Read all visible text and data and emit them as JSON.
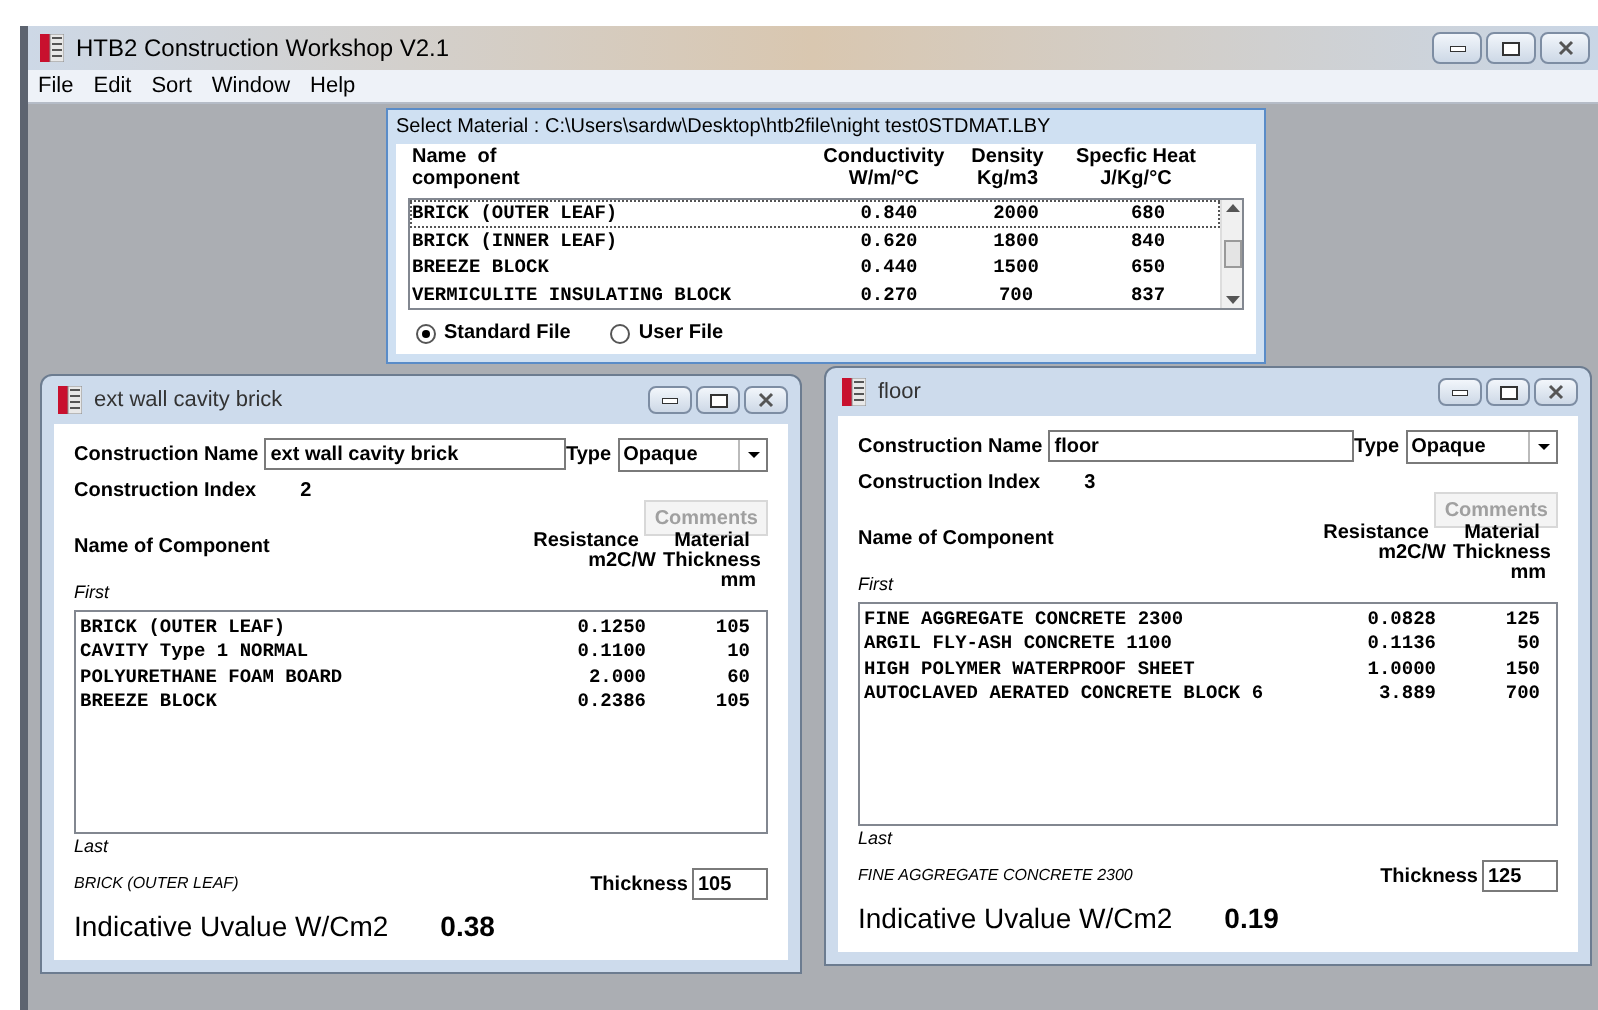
{
  "app": {
    "title": "HTB2 Construction Workshop V2.1",
    "menu": [
      "File",
      "Edit",
      "Sort",
      "Window",
      "Help"
    ]
  },
  "material_dialog": {
    "title": "Select Material : C:\\Users\\sardw\\Desktop\\htb2file\\night test0STDMAT.LBY",
    "columns": [
      {
        "lines": [
          "Name  of",
          "component"
        ]
      },
      {
        "lines": [
          "Conductivity",
          "W/m/°C"
        ]
      },
      {
        "lines": [
          "Density",
          "Kg/m3"
        ]
      },
      {
        "lines": [
          "Specfic Heat",
          "J/Kg/°C"
        ]
      }
    ],
    "rows": [
      {
        "cells": [
          "BRICK (OUTER LEAF)",
          "0.840",
          "2000",
          "680"
        ],
        "selected": true
      },
      {
        "cells": [
          "BRICK (INNER LEAF)",
          "0.620",
          "1800",
          "840"
        ],
        "selected": false
      },
      {
        "cells": [
          "BREEZE BLOCK",
          "0.440",
          "1500",
          "650"
        ],
        "selected": false
      },
      {
        "cells": [
          "VERMICULITE INSULATING BLOCK",
          "0.270",
          "700",
          "837"
        ],
        "selected": false
      }
    ],
    "sources": [
      {
        "label": "Standard File",
        "selected": true
      },
      {
        "label": "User File",
        "selected": false
      }
    ]
  },
  "constructions": [
    {
      "title": "ext wall cavity brick",
      "name_label": "Construction Name",
      "name_value": "ext wall cavity brick",
      "type_label": "Type",
      "type_value": "Opaque",
      "index_label": "Construction Index",
      "index_value": "2",
      "comments_button": {
        "label": "Comments",
        "disabled": true
      },
      "columns": [
        {
          "lines": [
            "Name of Component"
          ]
        },
        {
          "lines": [
            "Resistance",
            "m2C/W"
          ]
        },
        {
          "lines": [
            "Material",
            "Thickness",
            "mm"
          ]
        }
      ],
      "first_label": "First",
      "layers": [
        {
          "cells": [
            "BRICK (OUTER LEAF)",
            "0.1250",
            "105"
          ]
        },
        {
          "cells": [
            "CAVITY Type 1 NORMAL",
            "0.1100",
            "10"
          ]
        },
        {
          "cells": [
            "POLYURETHANE FOAM BOARD",
            "2.000",
            "60"
          ]
        },
        {
          "cells": [
            "BREEZE BLOCK",
            "0.2386",
            "105"
          ]
        }
      ],
      "last_label": "Last",
      "current_layer": "BRICK (OUTER LEAF)",
      "thickness_label": "Thickness",
      "thickness_value": "105",
      "uvalue_label": "Indicative Uvalue W/Cm2",
      "uvalue": "0.38"
    },
    {
      "title": "floor",
      "name_label": "Construction Name",
      "name_value": "floor",
      "type_label": "Type",
      "type_value": "Opaque",
      "index_label": "Construction Index",
      "index_value": "3",
      "comments_button": {
        "label": "Comments",
        "disabled": true
      },
      "columns": [
        {
          "lines": [
            "Name of Component"
          ]
        },
        {
          "lines": [
            "Resistance",
            "m2C/W"
          ]
        },
        {
          "lines": [
            "Material",
            "Thickness",
            "mm"
          ]
        }
      ],
      "first_label": "First",
      "layers": [
        {
          "cells": [
            "FINE AGGREGATE CONCRETE 2300",
            "0.0828",
            "125"
          ]
        },
        {
          "cells": [
            "ARGIL FLY-ASH CONCRETE 1100",
            "0.1136",
            "50"
          ]
        },
        {
          "cells": [
            "HIGH POLYMER WATERPROOF SHEET",
            "1.0000",
            "150"
          ]
        },
        {
          "cells": [
            "AUTOCLAVED AERATED CONCRETE BLOCK 6",
            "3.889",
            "700"
          ]
        }
      ],
      "last_label": "Last",
      "current_layer": "FINE AGGREGATE CONCRETE 2300",
      "thickness_label": "Thickness",
      "thickness_value": "125",
      "uvalue_label": "Indicative Uvalue W/Cm2",
      "uvalue": "0.19"
    }
  ]
}
